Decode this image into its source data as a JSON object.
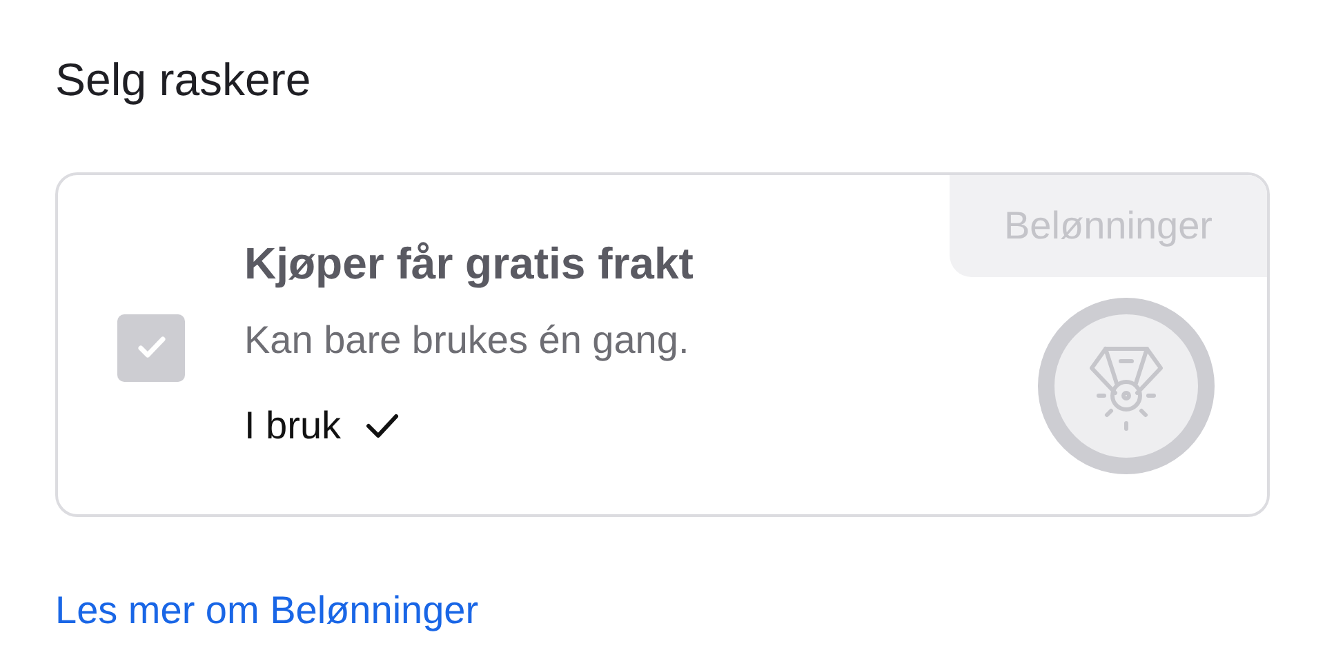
{
  "heading": "Selg raskere",
  "offer": {
    "checked": true,
    "disabled": true,
    "title": "Kjøper får gratis frakt",
    "subtitle": "Kan bare brukes én gang.",
    "status": "I bruk",
    "status_done": true,
    "badge": "Belønninger"
  },
  "link": "Les mer om Belønninger"
}
